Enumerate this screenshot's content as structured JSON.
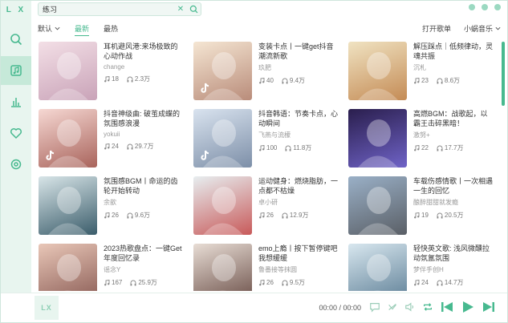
{
  "app": {
    "logo": "L X"
  },
  "search": {
    "value": "练习",
    "placeholder": ""
  },
  "toolbar": {
    "sort": "默认",
    "tab_latest": "最新",
    "tab_hot": "最热",
    "open_playlist": "打开歌单",
    "source": "小蜗音乐"
  },
  "colors": {
    "accent": "#47b98f",
    "sidebar_bg": "#e8f5ef"
  },
  "playlists": [
    {
      "title": "耳机避风港:来场极致的心动作战",
      "author": "change",
      "plays": "18",
      "listens": "2.3万"
    },
    {
      "title": "变装卡点丨一键get抖音潮流新歌",
      "author": "玖肥",
      "plays": "40",
      "listens": "9.4万"
    },
    {
      "title": "解压踩点｜低频律动，灵魂共振",
      "author": "沉札",
      "plays": "23",
      "listens": "8.6万"
    },
    {
      "title": "抖音神级曲: 破茧成蝶的氛围感浪漫",
      "author": "yokuii",
      "plays": "24",
      "listens": "29.7万"
    },
    {
      "title": "抖音韩语：节奏卡点，心动瞬间",
      "author": "飞燕与流檬",
      "plays": "100",
      "listens": "11.8万"
    },
    {
      "title": "高燃BGM：战歌起，以霸王击碎黑暗！",
      "author": "激努+",
      "plays": "22",
      "listens": "17.7万"
    },
    {
      "title": "氛围感BGM丨命运的齿轮开始转动",
      "author": "余歆",
      "plays": "26",
      "listens": "9.6万"
    },
    {
      "title": "运动健身：燃烧脂肪，一点都不枯燥",
      "author": "卓小研",
      "plays": "26",
      "listens": "12.9万"
    },
    {
      "title": "车载伤感情歌丨一次相遇一生的回忆",
      "author": "酿醉甜甜就发瘾",
      "plays": "19",
      "listens": "20.5万"
    },
    {
      "title": "2023热歌盘点：一键Get年度回忆录",
      "author": "谣念Y",
      "plays": "167",
      "listens": "25.9万"
    },
    {
      "title": "emo上瘾丨按下暂停键吧我想缓缓",
      "author": "鲁番接等抹圆",
      "plays": "26",
      "listens": "9.5万"
    },
    {
      "title": "轻快英文歌: 浅风微醺拉动氛氲氛围",
      "author": "梦伴手创H",
      "plays": "24",
      "listens": "14.7万"
    }
  ],
  "player": {
    "logo": "LX",
    "time": "00:00 / 00:00"
  },
  "icons": [
    "search-icon",
    "music-library-icon",
    "chart-icon",
    "heart-icon",
    "settings-icon",
    "tiktok-icon",
    "play-icon",
    "headphones-icon"
  ]
}
